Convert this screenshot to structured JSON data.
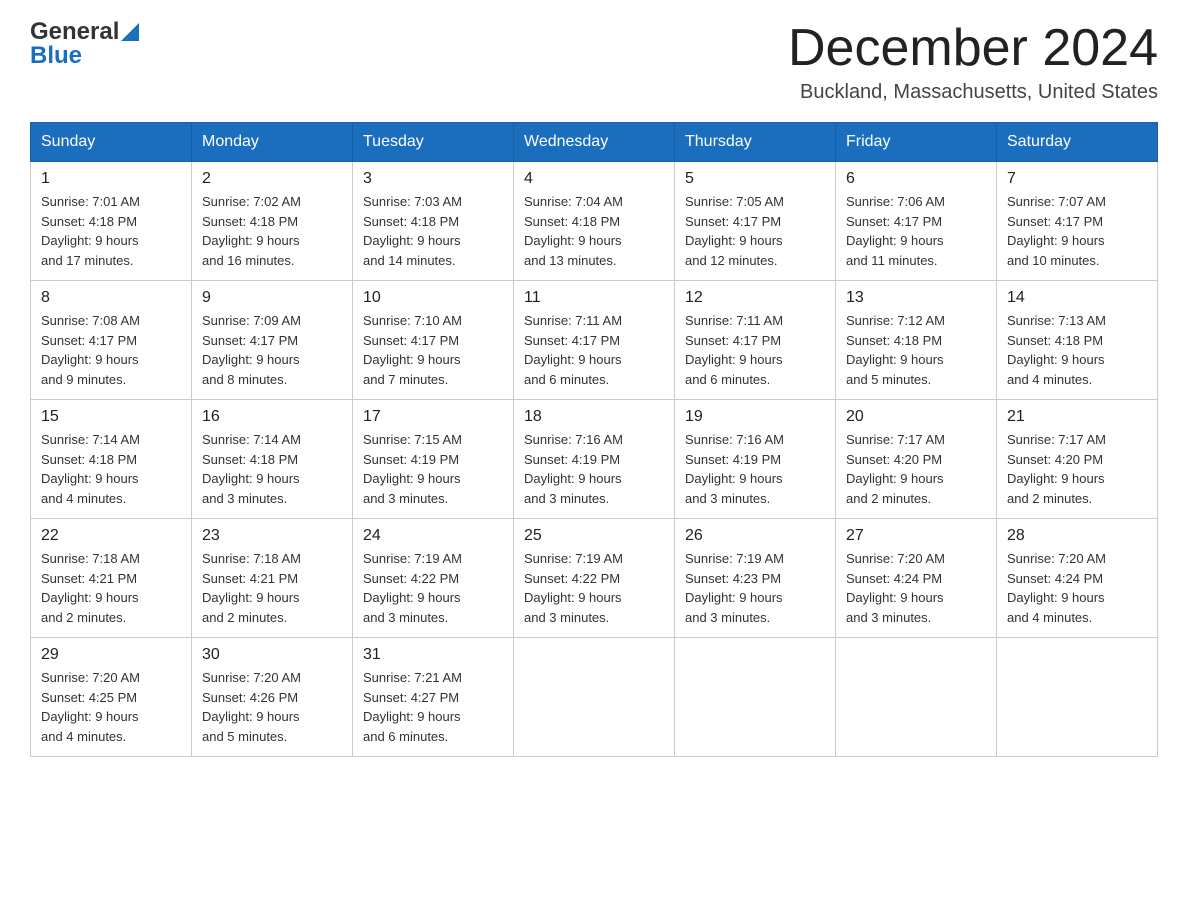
{
  "header": {
    "logo_general": "General",
    "logo_blue": "Blue",
    "month_title": "December 2024",
    "location": "Buckland, Massachusetts, United States"
  },
  "weekdays": [
    "Sunday",
    "Monday",
    "Tuesday",
    "Wednesday",
    "Thursday",
    "Friday",
    "Saturday"
  ],
  "weeks": [
    [
      {
        "day": "1",
        "sunrise": "7:01 AM",
        "sunset": "4:18 PM",
        "daylight": "9 hours and 17 minutes."
      },
      {
        "day": "2",
        "sunrise": "7:02 AM",
        "sunset": "4:18 PM",
        "daylight": "9 hours and 16 minutes."
      },
      {
        "day": "3",
        "sunrise": "7:03 AM",
        "sunset": "4:18 PM",
        "daylight": "9 hours and 14 minutes."
      },
      {
        "day": "4",
        "sunrise": "7:04 AM",
        "sunset": "4:18 PM",
        "daylight": "9 hours and 13 minutes."
      },
      {
        "day": "5",
        "sunrise": "7:05 AM",
        "sunset": "4:17 PM",
        "daylight": "9 hours and 12 minutes."
      },
      {
        "day": "6",
        "sunrise": "7:06 AM",
        "sunset": "4:17 PM",
        "daylight": "9 hours and 11 minutes."
      },
      {
        "day": "7",
        "sunrise": "7:07 AM",
        "sunset": "4:17 PM",
        "daylight": "9 hours and 10 minutes."
      }
    ],
    [
      {
        "day": "8",
        "sunrise": "7:08 AM",
        "sunset": "4:17 PM",
        "daylight": "9 hours and 9 minutes."
      },
      {
        "day": "9",
        "sunrise": "7:09 AM",
        "sunset": "4:17 PM",
        "daylight": "9 hours and 8 minutes."
      },
      {
        "day": "10",
        "sunrise": "7:10 AM",
        "sunset": "4:17 PM",
        "daylight": "9 hours and 7 minutes."
      },
      {
        "day": "11",
        "sunrise": "7:11 AM",
        "sunset": "4:17 PM",
        "daylight": "9 hours and 6 minutes."
      },
      {
        "day": "12",
        "sunrise": "7:11 AM",
        "sunset": "4:17 PM",
        "daylight": "9 hours and 6 minutes."
      },
      {
        "day": "13",
        "sunrise": "7:12 AM",
        "sunset": "4:18 PM",
        "daylight": "9 hours and 5 minutes."
      },
      {
        "day": "14",
        "sunrise": "7:13 AM",
        "sunset": "4:18 PM",
        "daylight": "9 hours and 4 minutes."
      }
    ],
    [
      {
        "day": "15",
        "sunrise": "7:14 AM",
        "sunset": "4:18 PM",
        "daylight": "9 hours and 4 minutes."
      },
      {
        "day": "16",
        "sunrise": "7:14 AM",
        "sunset": "4:18 PM",
        "daylight": "9 hours and 3 minutes."
      },
      {
        "day": "17",
        "sunrise": "7:15 AM",
        "sunset": "4:19 PM",
        "daylight": "9 hours and 3 minutes."
      },
      {
        "day": "18",
        "sunrise": "7:16 AM",
        "sunset": "4:19 PM",
        "daylight": "9 hours and 3 minutes."
      },
      {
        "day": "19",
        "sunrise": "7:16 AM",
        "sunset": "4:19 PM",
        "daylight": "9 hours and 3 minutes."
      },
      {
        "day": "20",
        "sunrise": "7:17 AM",
        "sunset": "4:20 PM",
        "daylight": "9 hours and 2 minutes."
      },
      {
        "day": "21",
        "sunrise": "7:17 AM",
        "sunset": "4:20 PM",
        "daylight": "9 hours and 2 minutes."
      }
    ],
    [
      {
        "day": "22",
        "sunrise": "7:18 AM",
        "sunset": "4:21 PM",
        "daylight": "9 hours and 2 minutes."
      },
      {
        "day": "23",
        "sunrise": "7:18 AM",
        "sunset": "4:21 PM",
        "daylight": "9 hours and 2 minutes."
      },
      {
        "day": "24",
        "sunrise": "7:19 AM",
        "sunset": "4:22 PM",
        "daylight": "9 hours and 3 minutes."
      },
      {
        "day": "25",
        "sunrise": "7:19 AM",
        "sunset": "4:22 PM",
        "daylight": "9 hours and 3 minutes."
      },
      {
        "day": "26",
        "sunrise": "7:19 AM",
        "sunset": "4:23 PM",
        "daylight": "9 hours and 3 minutes."
      },
      {
        "day": "27",
        "sunrise": "7:20 AM",
        "sunset": "4:24 PM",
        "daylight": "9 hours and 3 minutes."
      },
      {
        "day": "28",
        "sunrise": "7:20 AM",
        "sunset": "4:24 PM",
        "daylight": "9 hours and 4 minutes."
      }
    ],
    [
      {
        "day": "29",
        "sunrise": "7:20 AM",
        "sunset": "4:25 PM",
        "daylight": "9 hours and 4 minutes."
      },
      {
        "day": "30",
        "sunrise": "7:20 AM",
        "sunset": "4:26 PM",
        "daylight": "9 hours and 5 minutes."
      },
      {
        "day": "31",
        "sunrise": "7:21 AM",
        "sunset": "4:27 PM",
        "daylight": "9 hours and 6 minutes."
      },
      null,
      null,
      null,
      null
    ]
  ],
  "labels": {
    "sunrise": "Sunrise:",
    "sunset": "Sunset:",
    "daylight": "Daylight:"
  }
}
